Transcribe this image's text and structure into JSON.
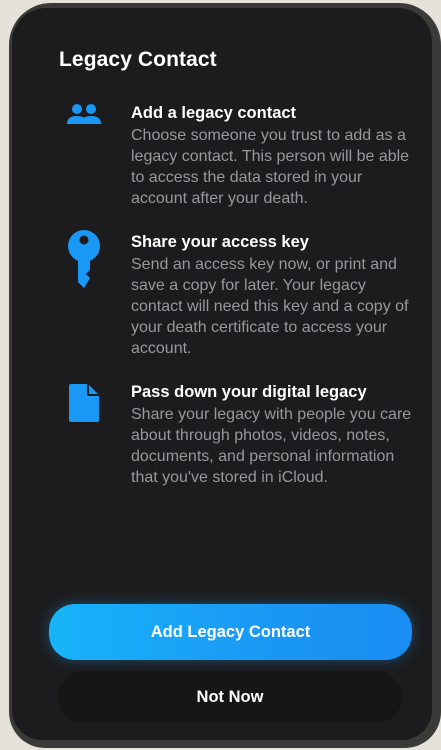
{
  "colors": {
    "accent": "#1a98f5",
    "background": "#1c1c1e",
    "text_primary": "#ffffff",
    "text_secondary": "#98989d"
  },
  "header": {
    "title": "Legacy Contact"
  },
  "features": [
    {
      "icon": "people-icon",
      "title": "Add a legacy contact",
      "description": "Choose someone you trust to add as a legacy contact. This person will be able to access the data stored in your account after your death."
    },
    {
      "icon": "key-icon",
      "title": "Share your access key",
      "description": "Send an access key now, or print and save a copy for later. Your legacy contact will need this key and a copy of your death certificate to access your account."
    },
    {
      "icon": "document-icon",
      "title": "Pass down your digital legacy",
      "description": "Share your legacy with people you care about through photos, videos, notes, documents, and personal information that you've stored in iCloud."
    }
  ],
  "actions": {
    "primary_label": "Add Legacy Contact",
    "secondary_label": "Not Now"
  }
}
